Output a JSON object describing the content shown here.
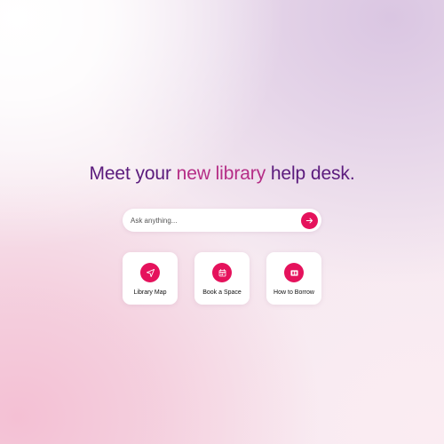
{
  "headline": {
    "part1": "Meet your ",
    "accent": "new library",
    "part2": " help desk."
  },
  "search": {
    "placeholder": "Ask anything...",
    "value": "",
    "send_icon": "arrow-right-icon"
  },
  "cards": [
    {
      "label": "Library Map",
      "icon": "navigation-arrow-icon"
    },
    {
      "label": "Book a Space",
      "icon": "calendar-icon"
    },
    {
      "label": "How to Borrow",
      "icon": "book-icon"
    }
  ],
  "colors": {
    "accent": "#e5125c",
    "headline": "#5b1b7d",
    "headline_accent": "#b52d86"
  }
}
